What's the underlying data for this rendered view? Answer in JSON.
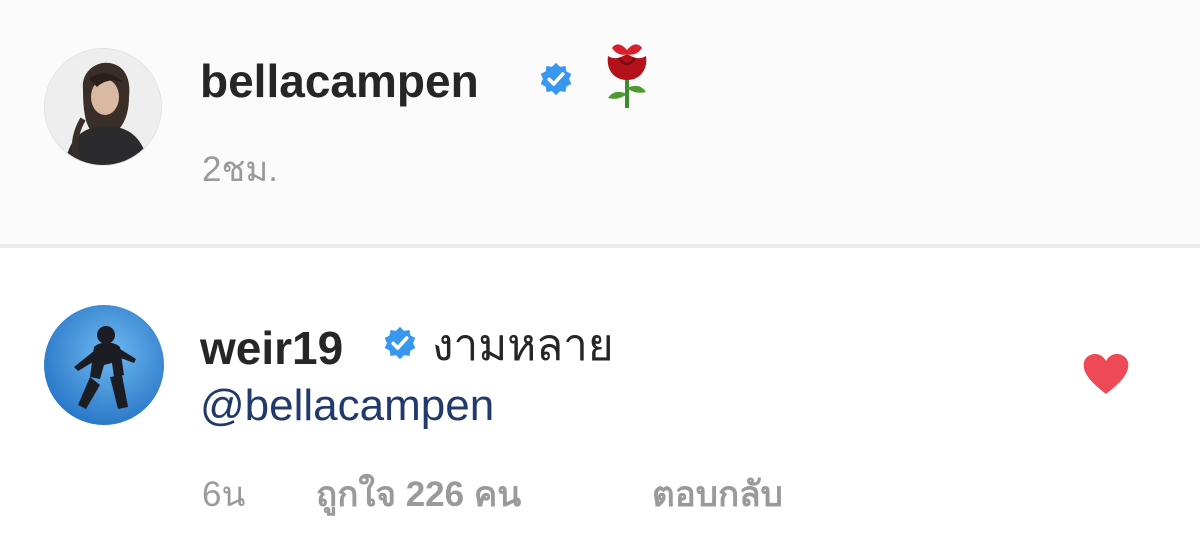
{
  "post": {
    "username": "bellacampen",
    "verified_icon": "verified-badge-icon",
    "emoji_icon": "rose-icon",
    "timestamp": "2ชม."
  },
  "comment": {
    "username": "weir19",
    "verified_icon": "verified-badge-icon",
    "text": "งามหลาย",
    "mention": "@bellacampen",
    "timestamp": "6น",
    "likes": "ถูกใจ 226 คน",
    "reply_label": "ตอบกลับ",
    "like_icon": "heart-icon"
  },
  "colors": {
    "verified": "#3897f0",
    "heart": "#ed4956",
    "mention": "#21396b",
    "secondary_text": "#9a9a9a"
  }
}
